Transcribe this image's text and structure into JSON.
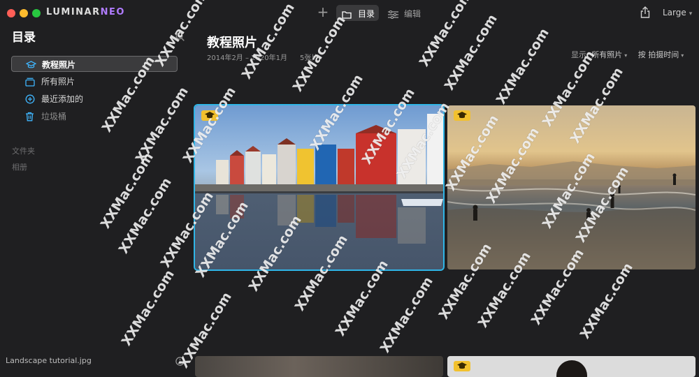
{
  "app": {
    "logo_main": "LUMINAR",
    "logo_accent": "NEO"
  },
  "toolbar": {
    "catalog_label": "目录",
    "edit_label": "编辑",
    "size_label": "Large"
  },
  "sidebar": {
    "title": "目录",
    "items": [
      {
        "label": "教程照片",
        "icon": "mortarboard-icon"
      },
      {
        "label": "所有照片",
        "icon": "photos-icon"
      },
      {
        "label": "最近添加的",
        "icon": "add-circle-icon"
      },
      {
        "label": "垃圾桶",
        "icon": "trash-icon"
      }
    ],
    "folders_label": "文件夹",
    "albums_label": "相册",
    "footer_filename": "Landscape tutorial.jpg"
  },
  "main": {
    "title": "教程照片",
    "date_range": "2014年2月 – 2020年1月",
    "photo_count": "5张片",
    "show_label": "显示:",
    "show_value": "所有照片",
    "sort_label": "按 拍摄时间"
  },
  "watermark": "XXMac.com",
  "colors": {
    "accent": "#2fb5e6",
    "badge": "#f2c12e",
    "background": "#1f1f21"
  }
}
